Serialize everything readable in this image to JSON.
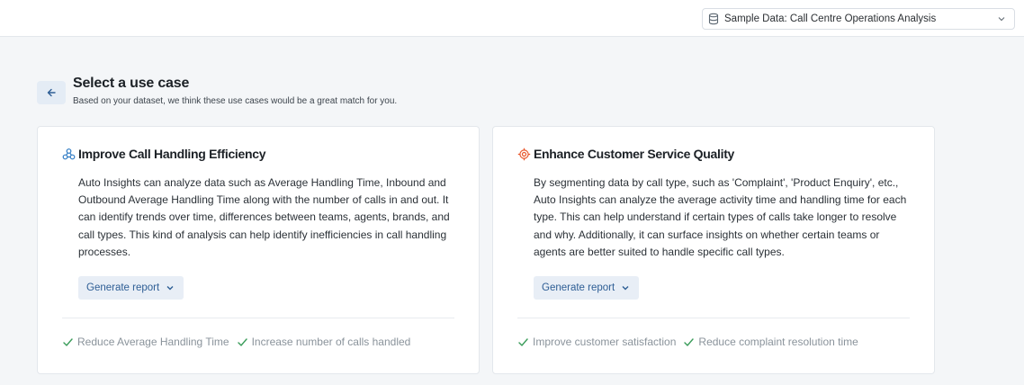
{
  "header": {
    "dataset_label": "Sample Data: Call Centre Operations Analysis"
  },
  "page": {
    "title": "Select a use case",
    "subtitle": "Based on your dataset, we think these use cases would be a great match for you."
  },
  "use_cases": [
    {
      "icon": "network-nodes-icon",
      "icon_color": "#2f7bc4",
      "title": "Improve Call Handling Efficiency",
      "description": "Auto Insights can analyze data such as Average Handling Time, Inbound and Outbound Average Handling Time along with the number of calls in and out. It can identify trends over time, differences between teams, agents, brands, and call types. This kind of analysis can help identify inefficiencies in call handling processes.",
      "button_label": "Generate report",
      "goals": [
        "Reduce Average Handling Time",
        "Increase number of calls handled"
      ]
    },
    {
      "icon": "target-icon",
      "icon_color": "#e8572c",
      "title": "Enhance Customer Service Quality",
      "description": "By segmenting data by call type, such as 'Complaint', 'Product Enquiry', etc., Auto Insights can analyze the average activity time and handling time for each type. This can help understand if certain types of calls take longer to resolve and why. Additionally, it can surface insights on whether certain teams or agents are better suited to handle specific call types.",
      "button_label": "Generate report",
      "goals": [
        "Improve customer satisfaction",
        "Reduce complaint resolution time"
      ]
    }
  ],
  "colors": {
    "accent": "#2e5e95",
    "check": "#3a9c5a"
  }
}
